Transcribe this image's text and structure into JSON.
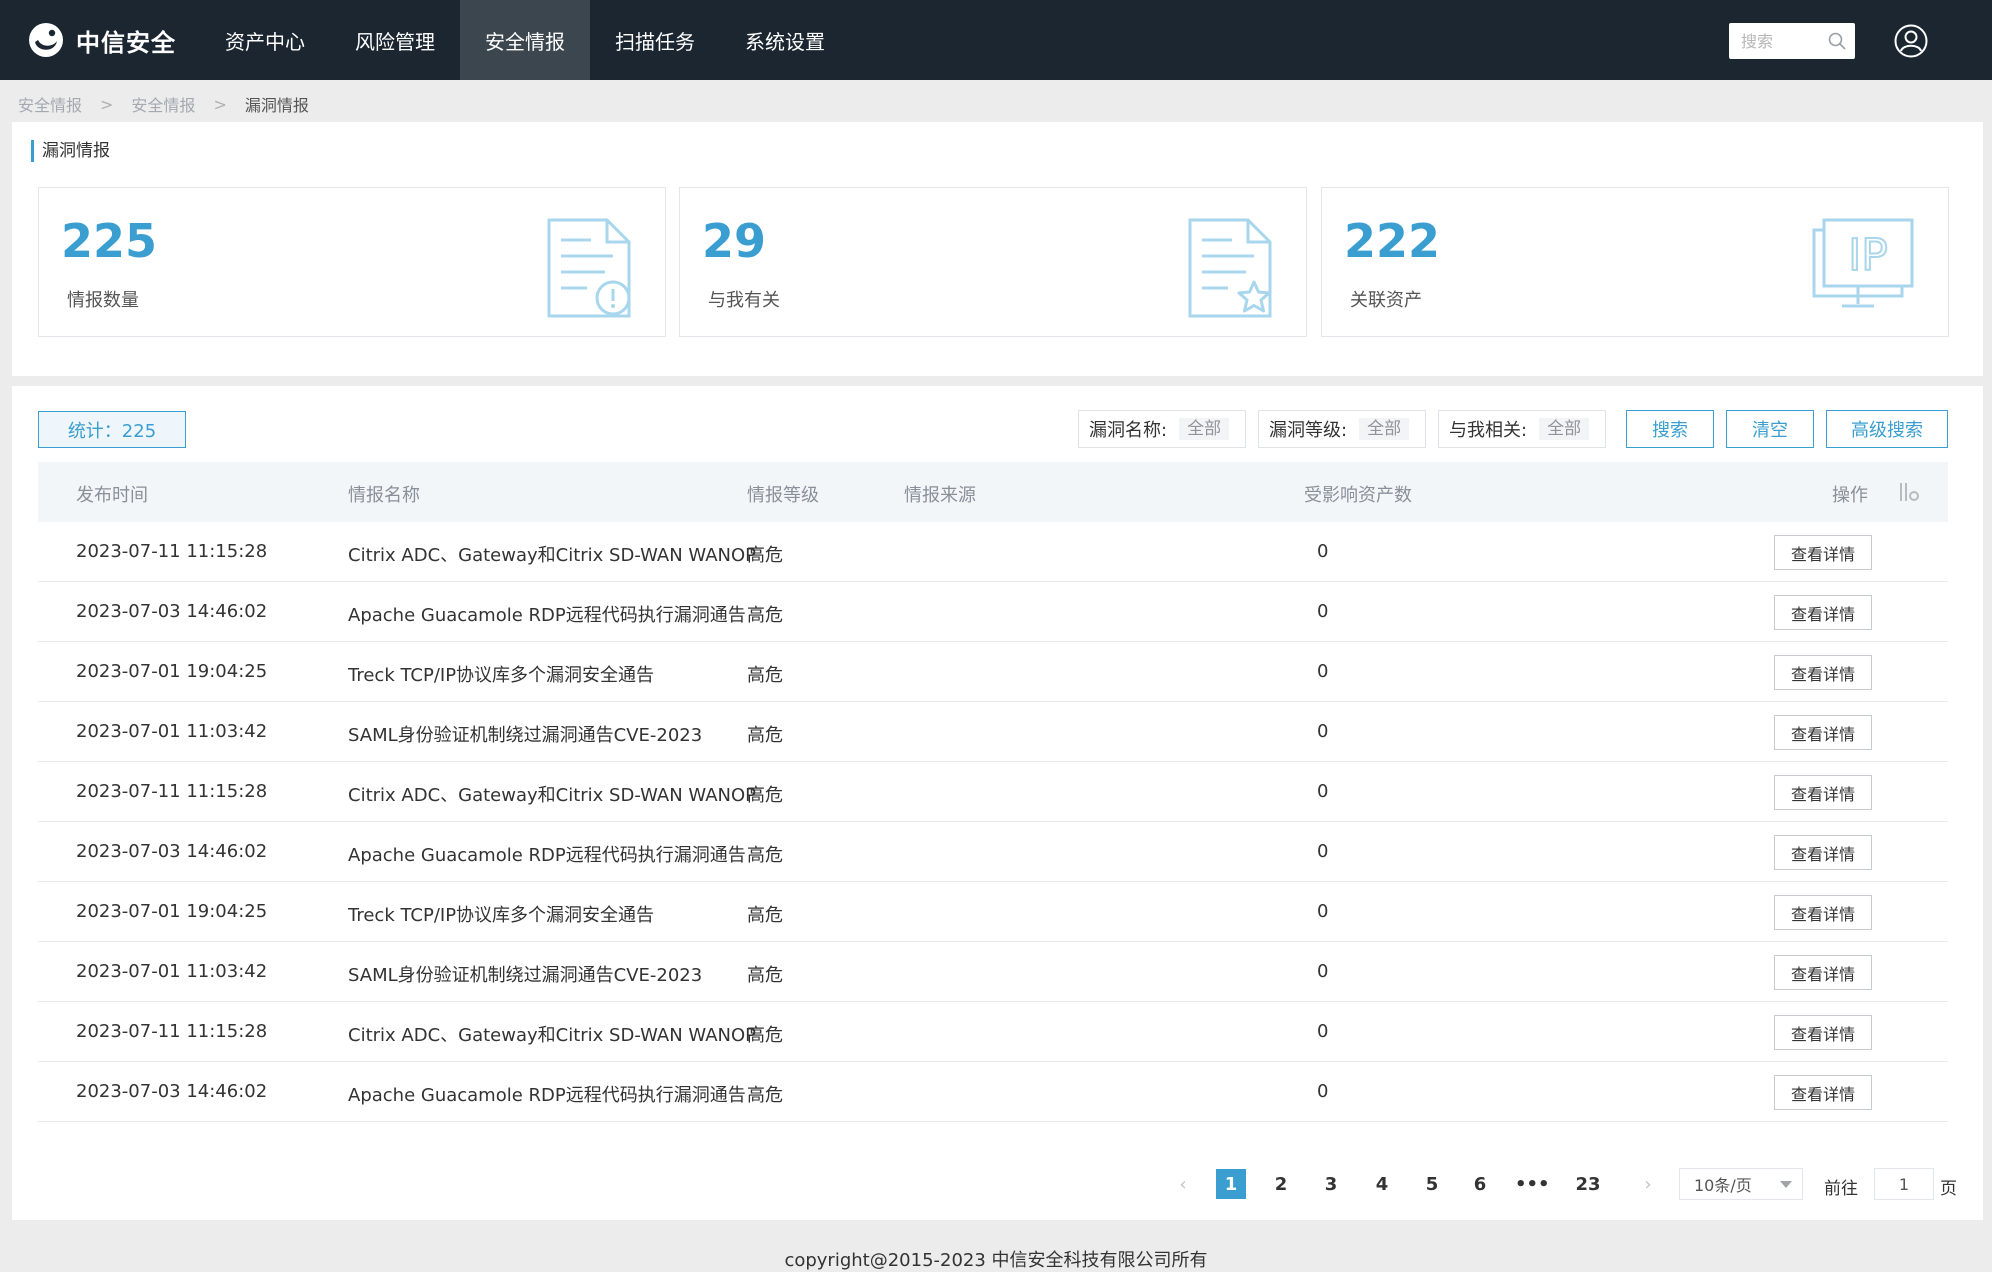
{
  "app": {
    "name": "中信安全"
  },
  "nav": {
    "items": [
      {
        "label": "资产中心",
        "active": false
      },
      {
        "label": "风险管理",
        "active": false
      },
      {
        "label": "安全情报",
        "active": true
      },
      {
        "label": "扫描任务",
        "active": false
      },
      {
        "label": "系统设置",
        "active": false
      }
    ],
    "search_placeholder": "搜索"
  },
  "breadcrumb": [
    "安全情报",
    "安全情报",
    "漏洞情报"
  ],
  "section": {
    "title": "漏洞情报"
  },
  "stats": [
    {
      "value": "225",
      "label": "情报数量",
      "icon": "document-alert-icon"
    },
    {
      "value": "29",
      "label": "与我有关",
      "icon": "document-star-icon"
    },
    {
      "value": "222",
      "label": "关联资产",
      "icon": "ip-monitor-icon"
    }
  ],
  "toolbar": {
    "count_label": "统计：225",
    "filters": [
      {
        "label": "漏洞名称:",
        "value": "全部"
      },
      {
        "label": "漏洞等级:",
        "value": "全部"
      },
      {
        "label": "与我相关:",
        "value": "全部"
      }
    ],
    "search_button": "搜索",
    "clear_button": "清空",
    "advanced_button": "高级搜索"
  },
  "table": {
    "columns": [
      "发布时间",
      "情报名称",
      "情报等级",
      "情报来源",
      "受影响资产数",
      "操作"
    ],
    "detail_label": "查看详情",
    "rows": [
      {
        "time": "2023-07-11 11:15:28",
        "name": "Citrix ADC、Gateway和Citrix SD-WAN WANOP",
        "level": "高危",
        "source": "",
        "assets": "0"
      },
      {
        "time": "2023-07-03 14:46:02",
        "name": "Apache Guacamole RDP远程代码执行漏洞通告",
        "level": "高危",
        "source": "",
        "assets": "0"
      },
      {
        "time": "2023-07-01 19:04:25",
        "name": "Treck TCP/IP协议库多个漏洞安全通告",
        "level": "高危",
        "source": "",
        "assets": "0"
      },
      {
        "time": "2023-07-01 11:03:42",
        "name": "SAML身份验证机制绕过漏洞通告CVE-2023",
        "level": "高危",
        "source": "",
        "assets": "0"
      },
      {
        "time": "2023-07-11 11:15:28",
        "name": "Citrix ADC、Gateway和Citrix SD-WAN WANOP",
        "level": "高危",
        "source": "",
        "assets": "0"
      },
      {
        "time": "2023-07-03 14:46:02",
        "name": "Apache Guacamole RDP远程代码执行漏洞通告",
        "level": "高危",
        "source": "",
        "assets": "0"
      },
      {
        "time": "2023-07-01 19:04:25",
        "name": "Treck TCP/IP协议库多个漏洞安全通告",
        "level": "高危",
        "source": "",
        "assets": "0"
      },
      {
        "time": "2023-07-01 11:03:42",
        "name": "SAML身份验证机制绕过漏洞通告CVE-2023",
        "level": "高危",
        "source": "",
        "assets": "0"
      },
      {
        "time": "2023-07-11 11:15:28",
        "name": "Citrix ADC、Gateway和Citrix SD-WAN WANOP",
        "level": "高危",
        "source": "",
        "assets": "0"
      },
      {
        "time": "2023-07-03 14:46:02",
        "name": "Apache Guacamole RDP远程代码执行漏洞通告",
        "level": "高危",
        "source": "",
        "assets": "0"
      }
    ]
  },
  "pagination": {
    "prev": "‹",
    "next": "›",
    "pages": [
      "1",
      "2",
      "3",
      "4",
      "5",
      "6",
      "•••",
      "23"
    ],
    "current": "1",
    "page_size": "10条/页",
    "goto_label": "前往",
    "goto_value": "1",
    "goto_suffix": "页"
  },
  "footer": {
    "copyright": "copyright@2015-2023 中信安全科技有限公司所有"
  },
  "colors": {
    "accent": "#3a9fd0",
    "topbar": "#1b2631",
    "nav_active": "#3b464f"
  }
}
